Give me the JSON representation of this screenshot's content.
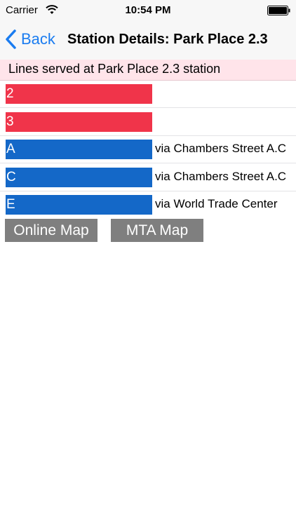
{
  "status_bar": {
    "carrier": "Carrier",
    "time": "10:54 PM"
  },
  "nav": {
    "back_label": "Back",
    "title": "Station Details: Park Place 2.3"
  },
  "section_header": "Lines served at Park Place 2.3 station",
  "lines": [
    {
      "name": "2",
      "route": "",
      "color": "#f0344a"
    },
    {
      "name": "3",
      "route": "",
      "color": "#f0344a"
    },
    {
      "name": "A",
      "route": "via Chambers Street A.C",
      "color": "#1468c8"
    },
    {
      "name": "C",
      "route": "via Chambers Street A.C",
      "color": "#1468c8"
    },
    {
      "name": "E",
      "route": "via World Trade Center",
      "color": "#1468c8"
    }
  ],
  "buttons": {
    "online_map": "Online Map",
    "mta_map": "MTA Map"
  },
  "colors": {
    "accent": "#1a7cf0",
    "button_gray": "#7f7f7f",
    "header_pink": "#ffe4ea"
  }
}
